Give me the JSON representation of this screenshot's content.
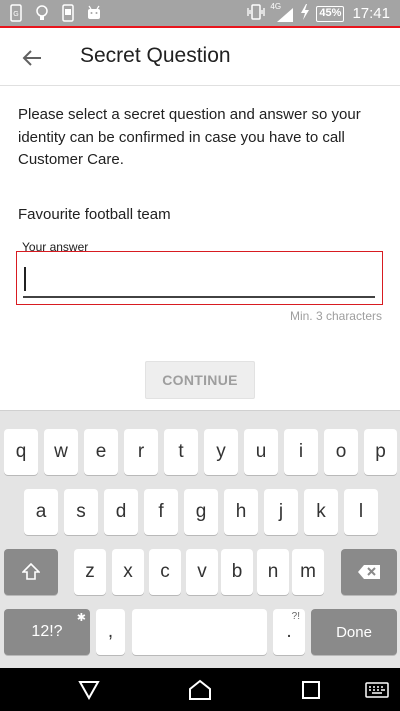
{
  "status_bar": {
    "network": "4G",
    "battery": "45%",
    "time": "17:41",
    "icons": [
      "phone-icon",
      "lightbulb-icon",
      "tablet-icon",
      "android-icon",
      "vibrate-icon",
      "signal-icon",
      "charging-icon"
    ]
  },
  "app_bar": {
    "title": "Secret Question"
  },
  "content": {
    "description": "Please select a secret question and answer so your identity can be confirmed in case you have to call Customer Care.",
    "question": "Favourite football team",
    "answer_label": "Your answer",
    "answer_value": "",
    "hint": "Min. 3 characters",
    "continue_label": "CONTINUE"
  },
  "colors": {
    "accent": "#d81b21",
    "status_bar": "#a4a4a4",
    "keyboard_bg": "#e4e4e4",
    "dark_key": "#8a8a8a"
  },
  "keyboard": {
    "row1": [
      "q",
      "w",
      "e",
      "r",
      "t",
      "y",
      "u",
      "i",
      "o",
      "p"
    ],
    "row2": [
      "a",
      "s",
      "d",
      "f",
      "g",
      "h",
      "j",
      "k",
      "l"
    ],
    "row3": [
      "z",
      "x",
      "c",
      "v",
      "b",
      "n",
      "m"
    ],
    "symbols_label": "12!?",
    "comma": ",",
    "period": ".",
    "period_sub": "?!",
    "done_label": "Done"
  }
}
